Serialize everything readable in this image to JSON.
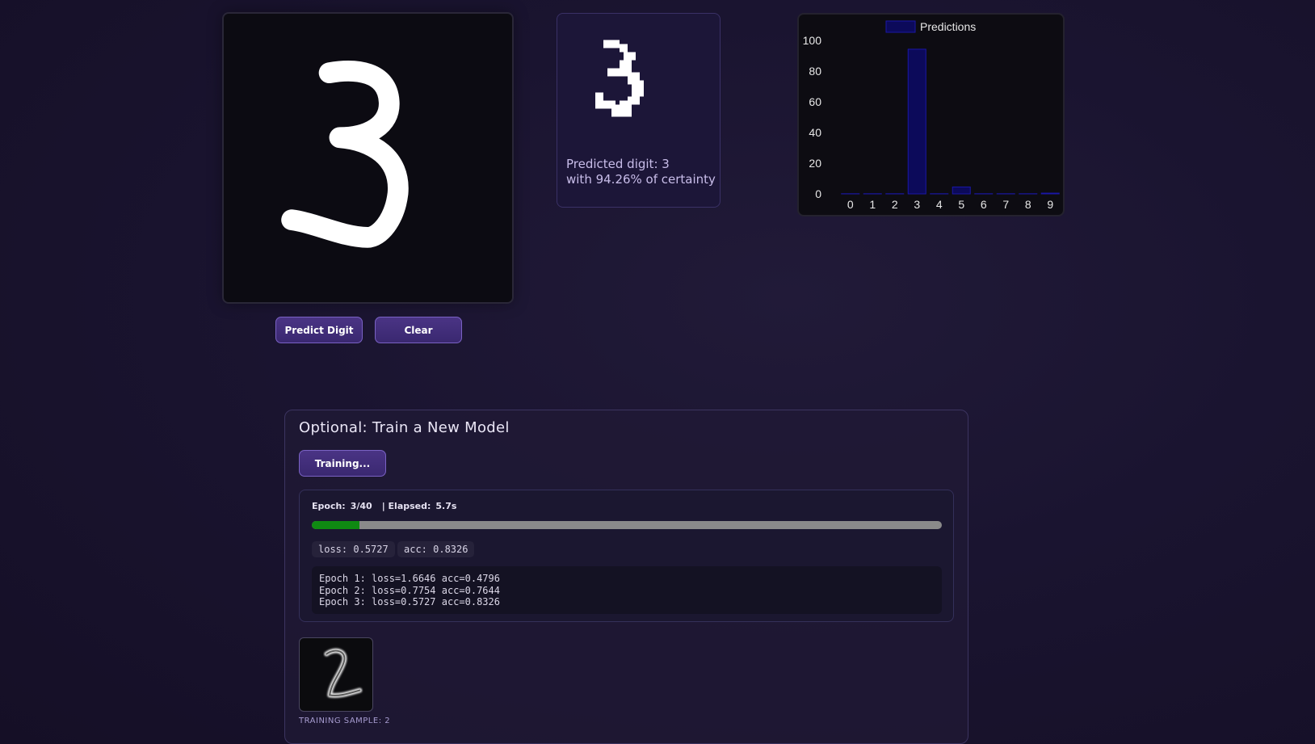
{
  "canvas": {
    "drawn_digit_icon": "handwritten-3"
  },
  "controls": {
    "predict_label": "Predict Digit",
    "clear_label": "Clear"
  },
  "prediction": {
    "line1": "Predicted digit: 3",
    "line2": "with 94.26% of certainty",
    "preview_icon": "pixelated-digit-3"
  },
  "chart_data": {
    "type": "bar",
    "categories": [
      "0",
      "1",
      "2",
      "3",
      "4",
      "5",
      "6",
      "7",
      "8",
      "9"
    ],
    "series": [
      {
        "name": "Predictions",
        "values": [
          0.1,
          0.1,
          0.1,
          94.26,
          0.1,
          4.5,
          0.1,
          0.1,
          0.1,
          0.5
        ]
      }
    ],
    "yticks": [
      "0",
      "20",
      "40",
      "60",
      "80",
      "100"
    ],
    "ylim": [
      0,
      100
    ],
    "grid": false,
    "legend": "top-center",
    "bar_color": "#0c0a5a",
    "bar_border": "#1a17a6"
  },
  "training": {
    "title": "Optional: Train a New Model",
    "button_label": "Training...",
    "epoch_label": "Epoch:",
    "epoch_value": "3/40",
    "elapsed_label": "| Elapsed:",
    "elapsed_value": "5.7s",
    "progress": 0.075,
    "progress_color": "#0f8a12",
    "loss_text": "loss: 0.5727",
    "acc_text": "acc: 0.8326",
    "log": [
      "Epoch 1: loss=1.6646 acc=0.4796",
      "Epoch 2: loss=0.7754 acc=0.7644",
      "Epoch 3: loss=0.5727 acc=0.8326"
    ],
    "sample_caption": "TRAINING SAMPLE: 2",
    "sample_icon": "mnist-digit-2"
  },
  "colors": {
    "accent": "#4a3485",
    "accent_border": "#7a62c4"
  }
}
